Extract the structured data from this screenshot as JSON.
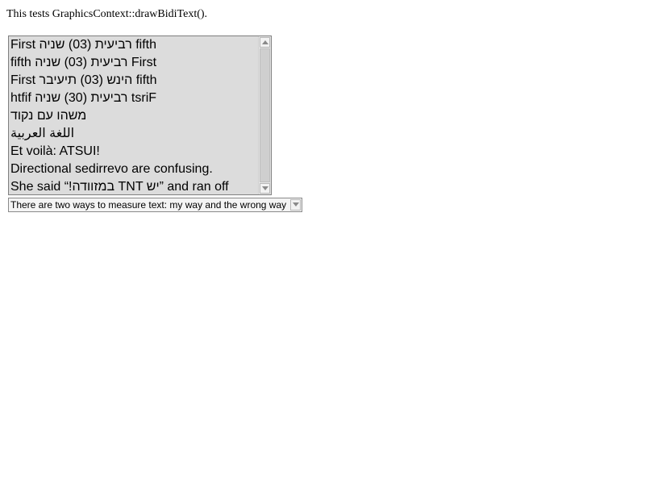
{
  "intro": {
    "text": "This tests GraphicsContext::drawBidiText()."
  },
  "listbox": {
    "items": [
      "First רביעית (03) שניה fifth",
      "fifth רביעית (03) שניה First",
      "First הינש (03) תיעיבר fifth",
      "htfif רביעית (30) שניה tsriF",
      "משהו עם נקוד",
      "اللغة العربية",
      "Et voilà: ATSUI!",
      "Directional sedirrevo are confusing.",
      "She said “!במזוודה TNT יש” and ran off"
    ]
  },
  "select": {
    "selected_value": "There are two ways to measure text: my way and the wrong way"
  },
  "icons": {
    "scroll_up": "scroll-up-arrow",
    "scroll_down": "scroll-down-arrow",
    "select_dropdown": "chevron-down"
  }
}
